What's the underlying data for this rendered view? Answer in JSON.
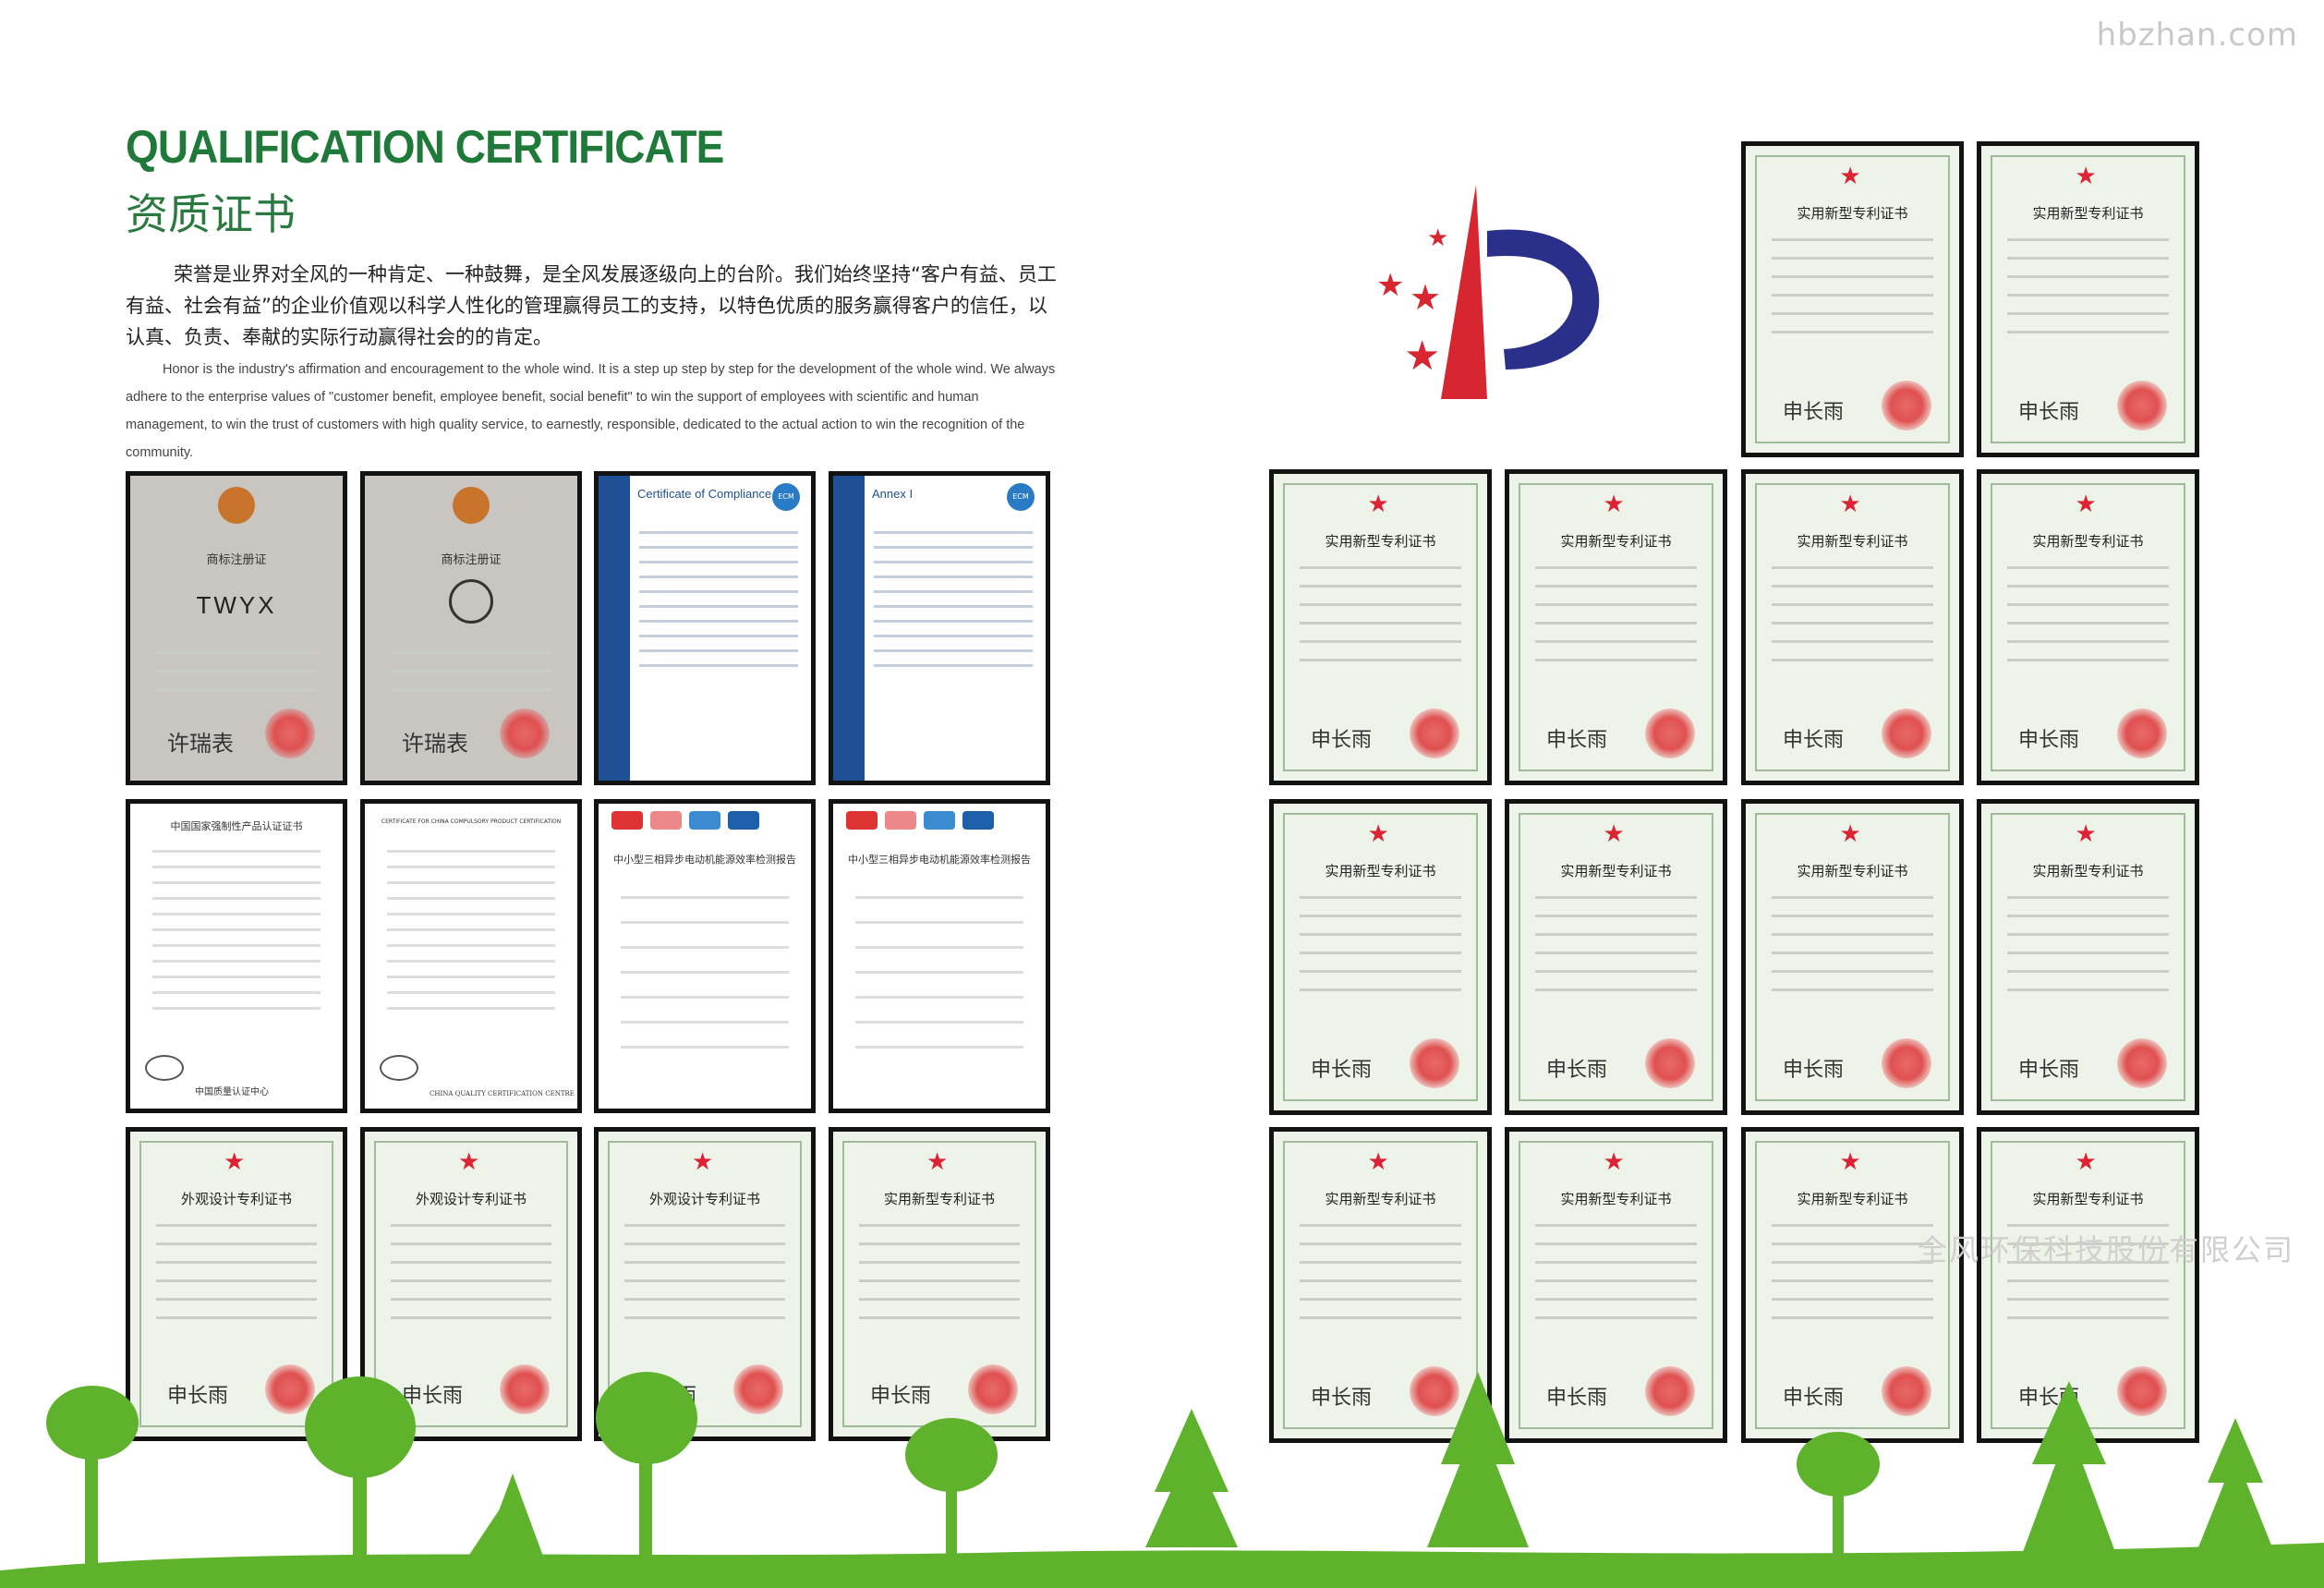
{
  "watermark_top": "hbzhan.com",
  "header": {
    "title_en": "QUALIFICATION CERTIFICATE",
    "title_zh": "资质证书"
  },
  "intro": {
    "zh": "荣誉是业界对全风的一种肯定、一种鼓舞，是全风发展逐级向上的台阶。我们始终坚持“客户有益、员工有益、社会有益”的企业价值观以科学人性化的管理赢得员工的支持，以特色优质的服务赢得客户的信任，以认真、负责、奉献的实际行动赢得社会的的肯定。",
    "en": "Honor is the industry's affirmation and encouragement to the whole wind. It is a step up step by step for the development of the whole wind. We always adhere to the enterprise values of \"customer benefit, employee benefit, social benefit\" to win the support of employees with scientific and human management, to win the trust of customers with high quality service, to earnestly, responsible, dedicated to the actual action to win the recognition of the community."
  },
  "certificates": {
    "trademark_1": {
      "title": "商标注册证",
      "mark": "TWYX",
      "signature": "许瑞表"
    },
    "trademark_2": {
      "title": "商标注册证",
      "signature": "许瑞表"
    },
    "ce_1": {
      "title": "Certificate of Compliance",
      "badge": "ECM"
    },
    "ce_2": {
      "title": "Annex I",
      "badge": "ECM"
    },
    "ccc_1": {
      "title": "中国国家强制性产品认证证书",
      "footer": "中国质量认证中心"
    },
    "ccc_2": {
      "title": "CERTIFICATE FOR CHINA COMPULSORY PRODUCT CERTIFICATION",
      "footer": "CHINA QUALITY CERTIFICATION CENTRE"
    },
    "report_1": {
      "title": "中小型三相异步电动机能源效率检测报告"
    },
    "report_2": {
      "title": "中小型三相异步电动机能源效率检测报告"
    },
    "design_patent_title": "外观设计专利证书",
    "utility_patent_title": "实用新型专利证书",
    "patent_signature": "申长雨"
  },
  "company_watermark": "全风环保科技股份有限公司",
  "colors": {
    "title_green": "#1f7a3a",
    "logo_red": "#d7262f",
    "logo_blue": "#2a2f8a",
    "tree_green": "#5fb32c"
  }
}
